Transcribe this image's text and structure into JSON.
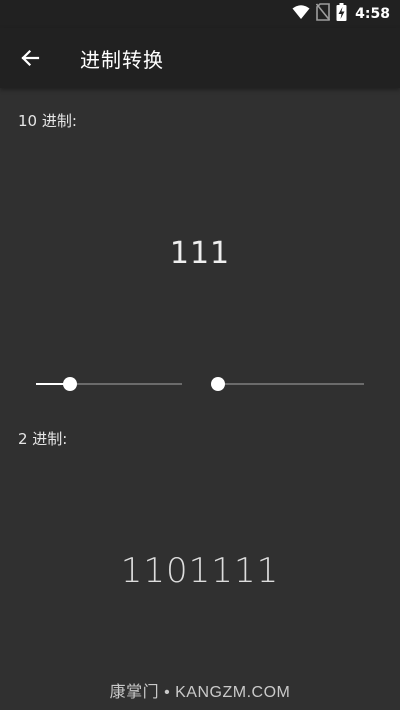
{
  "status_bar": {
    "time": "4:58",
    "icons": [
      "wifi-icon",
      "no-sim-icon",
      "battery-charging-icon"
    ]
  },
  "app_bar": {
    "back_icon": "arrow-left-icon",
    "title": "进制转换"
  },
  "decimal": {
    "label": "10 进制:",
    "value": "111"
  },
  "sliders": {
    "left": {
      "value": 0.23
    },
    "right": {
      "value": 0.0
    }
  },
  "binary": {
    "label": "2 进制:",
    "value": "1101111"
  },
  "watermark": {
    "text": "康掌门 • KANGZM.COM"
  },
  "colors": {
    "background": "#303030",
    "app_bar": "#212121",
    "accent": "#ffffff"
  }
}
